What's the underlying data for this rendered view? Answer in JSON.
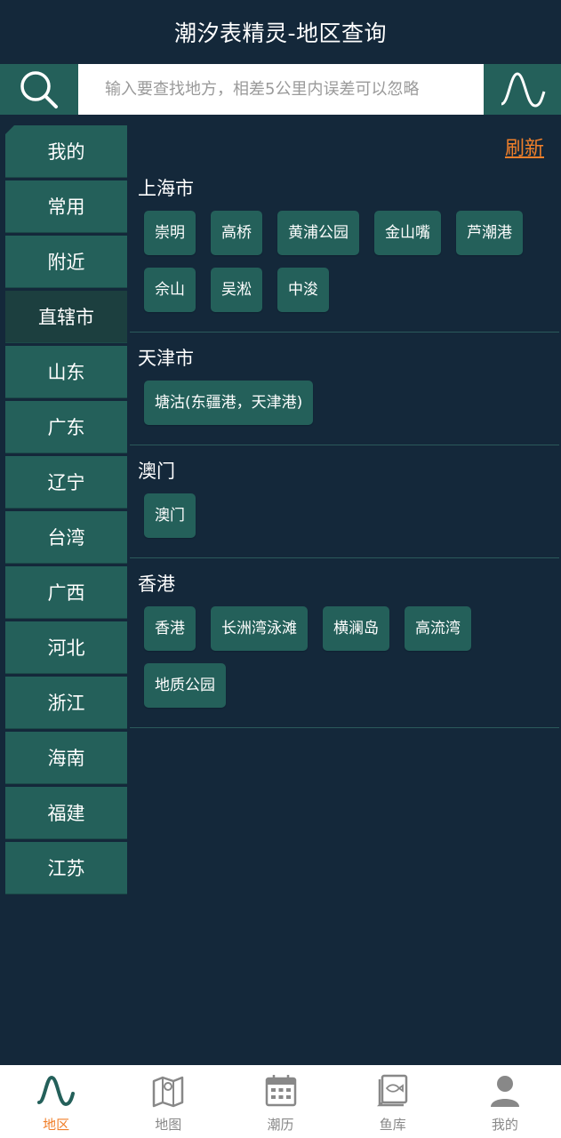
{
  "header": {
    "title": "潮汐表精灵-地区查询"
  },
  "search": {
    "placeholder": "输入要查找地方，相差5公里内误差可以忽略"
  },
  "colors": {
    "accent": "#f07f2a",
    "teal": "#24605a",
    "background": "#14283a"
  },
  "sidebar": {
    "items": [
      {
        "label": "我的"
      },
      {
        "label": "常用"
      },
      {
        "label": "附近"
      },
      {
        "label": "直辖市"
      },
      {
        "label": "山东"
      },
      {
        "label": "广东"
      },
      {
        "label": "辽宁"
      },
      {
        "label": "台湾"
      },
      {
        "label": "广西"
      },
      {
        "label": "河北"
      },
      {
        "label": "浙江"
      },
      {
        "label": "海南"
      },
      {
        "label": "福建"
      },
      {
        "label": "江苏"
      }
    ],
    "active_index": 3
  },
  "content": {
    "refresh_label": "刷新",
    "sections": [
      {
        "title": "上海市",
        "places": [
          "崇明",
          "高桥",
          "黄浦公园",
          "金山嘴",
          "芦潮港",
          "佘山",
          "吴淞",
          "中浚"
        ]
      },
      {
        "title": "天津市",
        "places": [
          "塘沽(东疆港，天津港)"
        ]
      },
      {
        "title": "澳门",
        "places": [
          "澳门"
        ]
      },
      {
        "title": "香港",
        "places": [
          "香港",
          "长洲湾泳滩",
          "横澜岛",
          "高流湾",
          "地质公园"
        ]
      }
    ]
  },
  "bottom_nav": {
    "items": [
      {
        "label": "地区",
        "icon": "wave-icon",
        "active": true
      },
      {
        "label": "地图",
        "icon": "map-icon",
        "active": false
      },
      {
        "label": "潮历",
        "icon": "calendar-icon",
        "active": false
      },
      {
        "label": "鱼库",
        "icon": "fish-book-icon",
        "active": false
      },
      {
        "label": "我的",
        "icon": "user-icon",
        "active": false
      }
    ]
  }
}
